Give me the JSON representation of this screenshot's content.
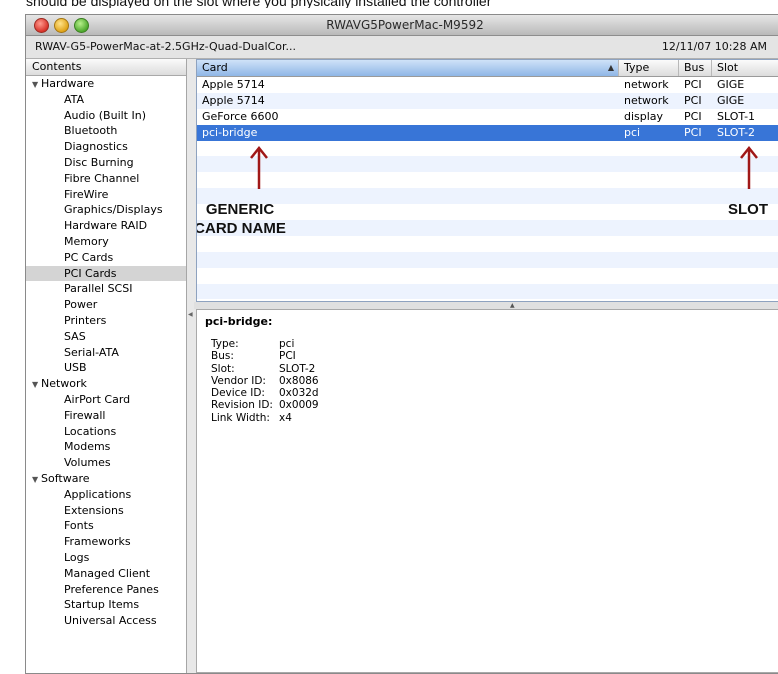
{
  "top_caption": "should be displayed on the slot where you physically installed the controller",
  "window": {
    "title": "RWAVG5PowerMac-M9592",
    "machine_label": "RWAV-G5-PowerMac-at-2.5GHz-Quad-DualCor...",
    "datetime": "12/11/07 10:28 AM"
  },
  "sidebar": {
    "header": "Contents",
    "groups": [
      {
        "label": "Hardware",
        "items": [
          "ATA",
          "Audio (Built In)",
          "Bluetooth",
          "Diagnostics",
          "Disc Burning",
          "Fibre Channel",
          "FireWire",
          "Graphics/Displays",
          "Hardware RAID",
          "Memory",
          "PC Cards",
          "PCI Cards",
          "Parallel SCSI",
          "Power",
          "Printers",
          "SAS",
          "Serial-ATA",
          "USB"
        ]
      },
      {
        "label": "Network",
        "items": [
          "AirPort Card",
          "Firewall",
          "Locations",
          "Modems",
          "Volumes"
        ]
      },
      {
        "label": "Software",
        "items": [
          "Applications",
          "Extensions",
          "Fonts",
          "Frameworks",
          "Logs",
          "Managed Client",
          "Preference Panes",
          "Startup Items",
          "Universal Access"
        ]
      }
    ],
    "selected_item": "PCI Cards"
  },
  "table": {
    "columns": [
      "Card",
      "Type",
      "Bus",
      "Slot"
    ],
    "rows": [
      {
        "card": "Apple 5714",
        "type": "network",
        "bus": "PCI",
        "slot": "GIGE"
      },
      {
        "card": "Apple 5714",
        "type": "network",
        "bus": "PCI",
        "slot": "GIGE"
      },
      {
        "card": "GeForce 6600",
        "type": "display",
        "bus": "PCI",
        "slot": "SLOT-1"
      },
      {
        "card": "pci-bridge",
        "type": "pci",
        "bus": "PCI",
        "slot": "SLOT-2"
      }
    ],
    "selected_row": 3
  },
  "annotations": {
    "generic_card_name": [
      "GENERIC",
      "CARD NAME"
    ],
    "slot": "SLOT"
  },
  "detail": {
    "title": "pci-bridge:",
    "properties": [
      {
        "label": "Type:",
        "value": "pci"
      },
      {
        "label": "Bus:",
        "value": "PCI"
      },
      {
        "label": "Slot:",
        "value": "SLOT-2"
      },
      {
        "label": "Vendor ID:",
        "value": "0x8086"
      },
      {
        "label": "Device ID:",
        "value": "0x032d"
      },
      {
        "label": "Revision ID:",
        "value": "0x0009"
      },
      {
        "label": "Link Width:",
        "value": "x4"
      }
    ]
  },
  "colors": {
    "selection_blue": "#3875d7",
    "alt_row": "#edf3fe",
    "annotation_arrow": "#a01818"
  }
}
